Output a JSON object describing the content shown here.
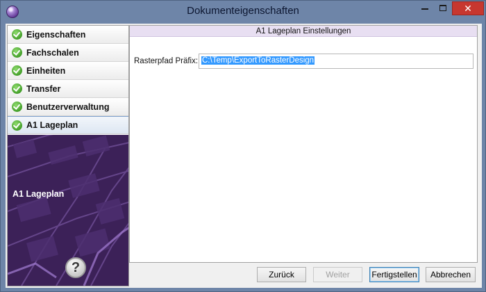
{
  "window": {
    "title": "Dokumenteigenschaften",
    "close_glyph": "✕",
    "icons": {
      "app": "app-orb-icon",
      "minimize": "minimize-icon",
      "maximize": "maximize-icon",
      "close": "close-icon"
    }
  },
  "sidebar": {
    "items": [
      {
        "label": "Eigenschaften",
        "icon": "green-check-icon"
      },
      {
        "label": "Fachschalen",
        "icon": "green-check-icon"
      },
      {
        "label": "Einheiten",
        "icon": "green-check-icon"
      },
      {
        "label": "Transfer",
        "icon": "green-check-icon"
      },
      {
        "label": "Benutzerverwaltung",
        "icon": "green-check-icon"
      },
      {
        "label": "A1 Lageplan",
        "icon": "green-check-icon",
        "selected": true
      }
    ],
    "image_caption": "A1 Lageplan",
    "help_label": "?"
  },
  "panel": {
    "header": "A1 Lageplan Einstellungen",
    "field_label": "Rasterpfad Präfix:",
    "field_value": "C:\\Temp\\ExportToRasterDesign"
  },
  "buttons": {
    "back": "Zurück",
    "next": "Weiter",
    "finish": "Fertigstellen",
    "cancel": "Abbrechen"
  },
  "colors": {
    "titlebar": "#6e85a8",
    "close_button": "#c7372f",
    "nav_image": "#3c2158",
    "panel_header": "#e8dff2",
    "selection": "#3399ff"
  }
}
